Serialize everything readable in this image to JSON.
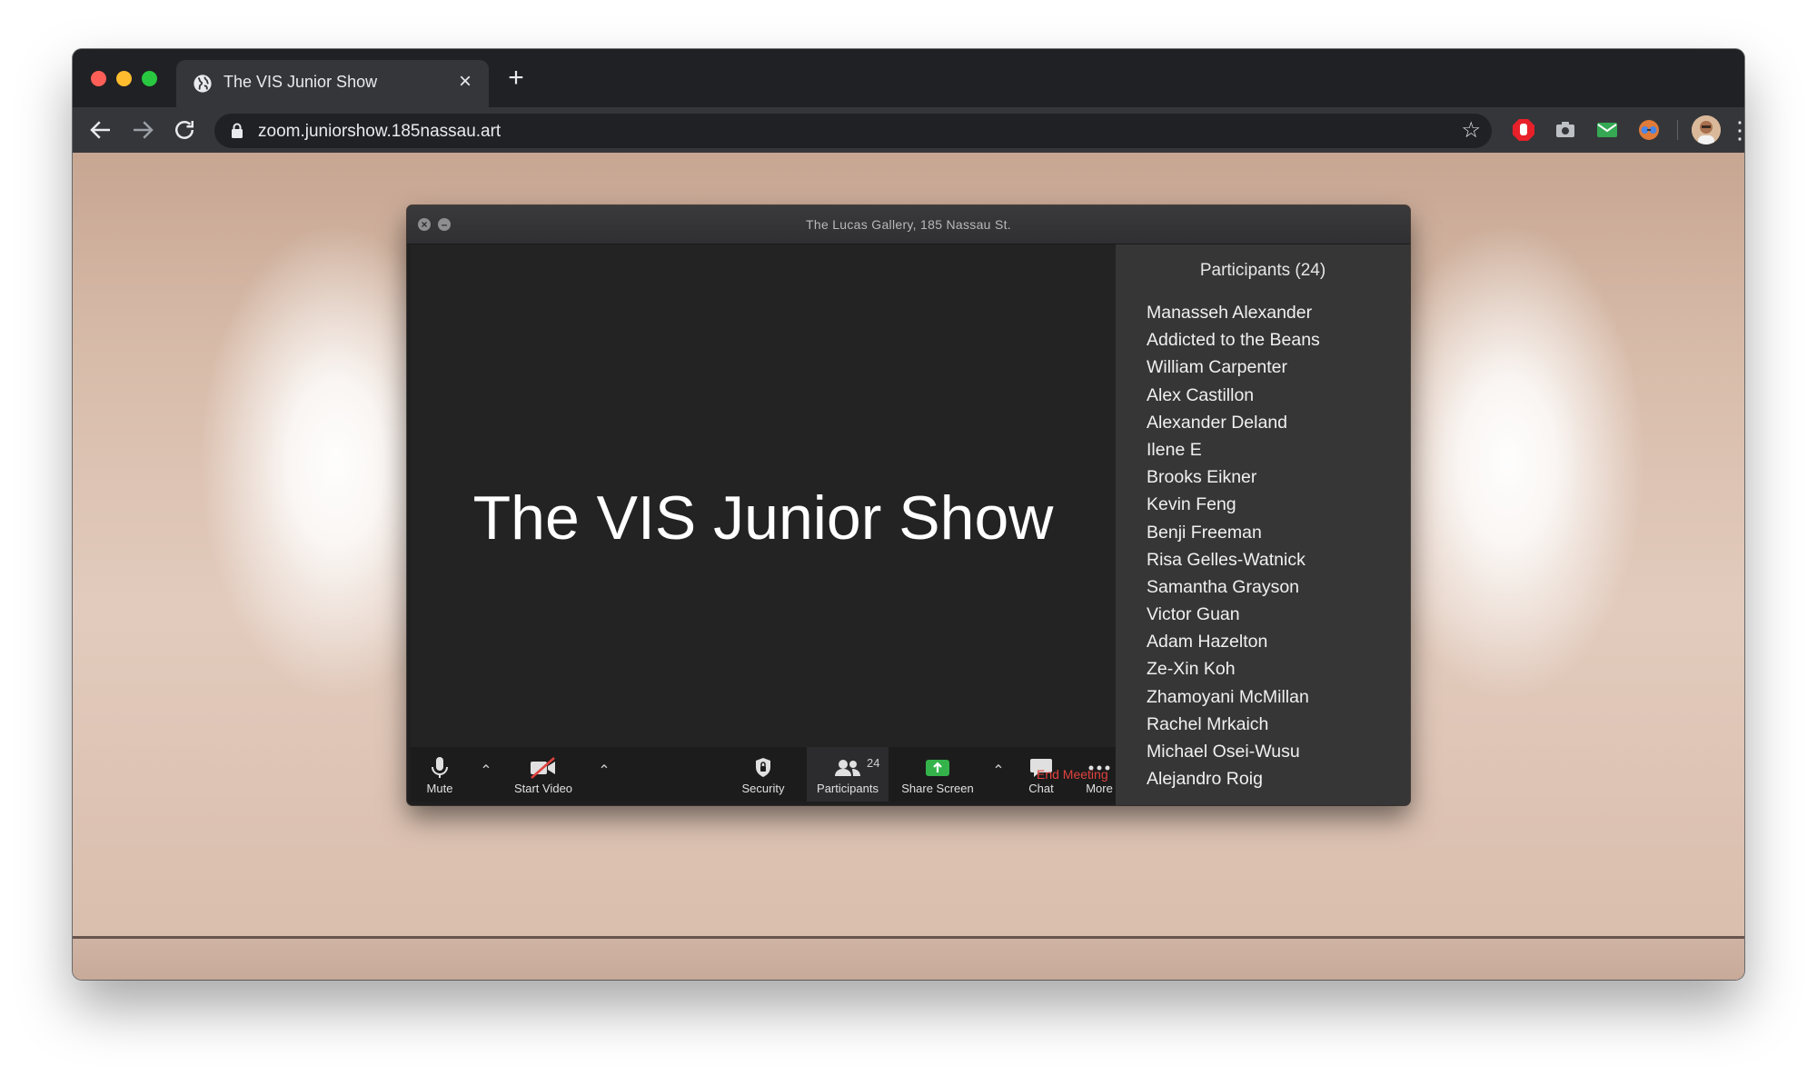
{
  "browser": {
    "tab_title": "The VIS Junior Show",
    "tab_close": "×",
    "new_tab": "+",
    "url": "zoom.juniorshow.185nassau.art",
    "icons": {
      "back": "arrow-left-icon",
      "forward": "arrow-right-icon",
      "reload": "reload-icon",
      "lock": "lock-icon",
      "bookmark": "star-icon",
      "menu": "kebab-menu-icon"
    }
  },
  "zoom": {
    "window_title": "The Lucas Gallery, 185 Nassau St.",
    "stage_text": "The VIS Junior Show",
    "controls": {
      "mute": "Mute",
      "start_video": "Start Video",
      "security": "Security",
      "participants": "Participants",
      "participants_count": "24",
      "share_screen": "Share Screen",
      "chat": "Chat",
      "more": "More",
      "end_meeting": "End Meeting"
    },
    "participants_panel": {
      "header": "Participants (24)",
      "names": [
        "Manasseh Alexander",
        "Addicted to the Beans",
        "William Carpenter",
        "Alex Castillon",
        "Alexander Deland",
        "Ilene E",
        "Brooks Eikner",
        "Kevin Feng",
        "Benji Freeman",
        "Risa Gelles-Watnick",
        "Samantha Grayson",
        "Victor Guan",
        "Adam Hazelton",
        "Ze-Xin Koh",
        "Zhamoyani McMillan",
        "Rachel Mrkaich",
        "Michael Osei-Wusu",
        "Alejandro Roig"
      ]
    }
  },
  "colors": {
    "end_meeting": "#e0423d",
    "share_screen_green": "#33b34a",
    "extension_red": "#e8202a"
  }
}
